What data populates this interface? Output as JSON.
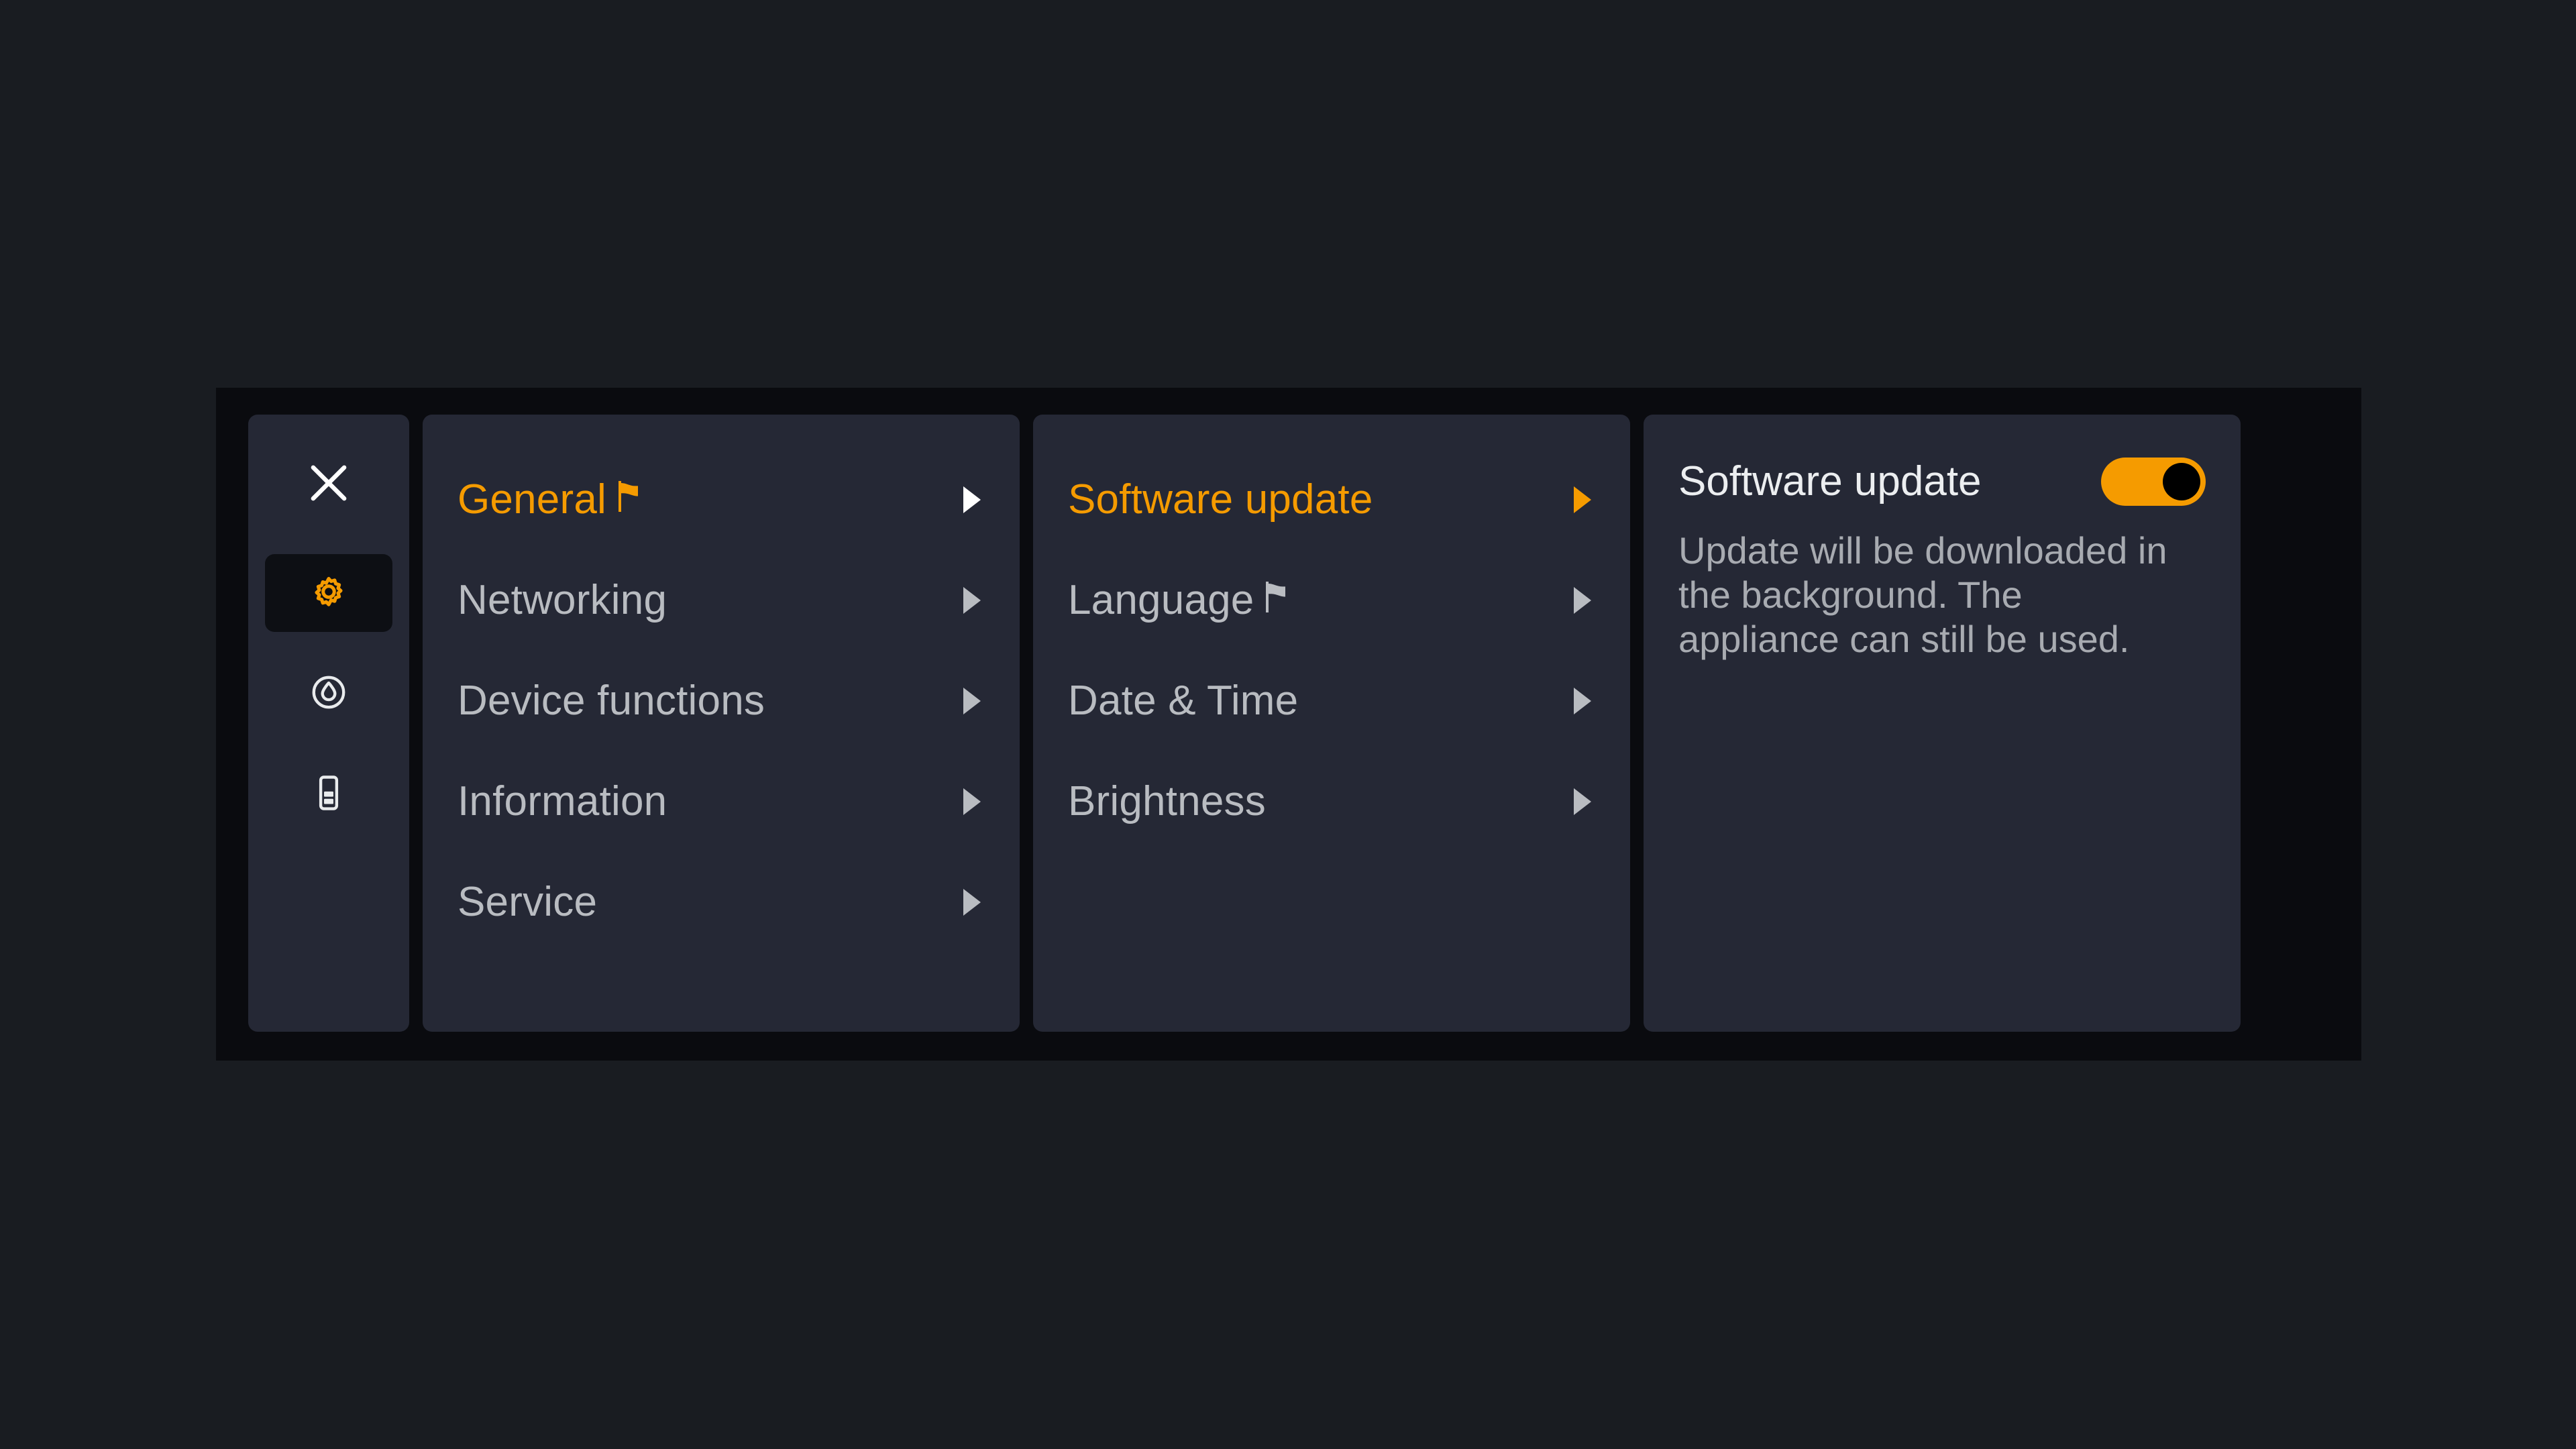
{
  "theme": {
    "page_background": "#191c21",
    "overlay_background": "#0a0b0f",
    "panel_background": "#252835",
    "accent": "#F59B00",
    "text_primary": "#eceef0",
    "text_secondary": "#b9bcc1",
    "text_muted": "#a8abb1",
    "toggle_knob": "#000000",
    "rail_active_background": "#0d0f14"
  },
  "rail": {
    "close_icon": "close-icon",
    "items": [
      {
        "icon": "gear-icon",
        "name": "settings",
        "active": true
      },
      {
        "icon": "water-drop-icon",
        "name": "water",
        "active": false
      },
      {
        "icon": "cartridge-icon",
        "name": "cartridge",
        "active": false
      }
    ]
  },
  "menu_level_1": {
    "items": [
      {
        "label": "General",
        "selected": true,
        "icon": "flag-icon",
        "chevron": "caret-right-icon"
      },
      {
        "label": "Networking",
        "selected": false,
        "icon": null,
        "chevron": "caret-right-icon"
      },
      {
        "label": "Device functions",
        "selected": false,
        "icon": null,
        "chevron": "caret-right-icon"
      },
      {
        "label": "Information",
        "selected": false,
        "icon": null,
        "chevron": "caret-right-icon"
      },
      {
        "label": "Service",
        "selected": false,
        "icon": null,
        "chevron": "caret-right-icon"
      }
    ]
  },
  "menu_level_2": {
    "items": [
      {
        "label": "Software update",
        "selected": true,
        "icon": null,
        "chevron": "caret-right-icon"
      },
      {
        "label": "Language",
        "selected": false,
        "icon": "flag-icon",
        "chevron": "caret-right-icon"
      },
      {
        "label": "Date & Time",
        "selected": false,
        "icon": null,
        "chevron": "caret-right-icon"
      },
      {
        "label": "Brightness",
        "selected": false,
        "icon": null,
        "chevron": "caret-right-icon"
      }
    ]
  },
  "detail": {
    "title": "Software update",
    "toggle": {
      "name": "software-update-toggle",
      "state": "on"
    },
    "description": "Update will be downloaded in the background. The appliance can still be used."
  }
}
